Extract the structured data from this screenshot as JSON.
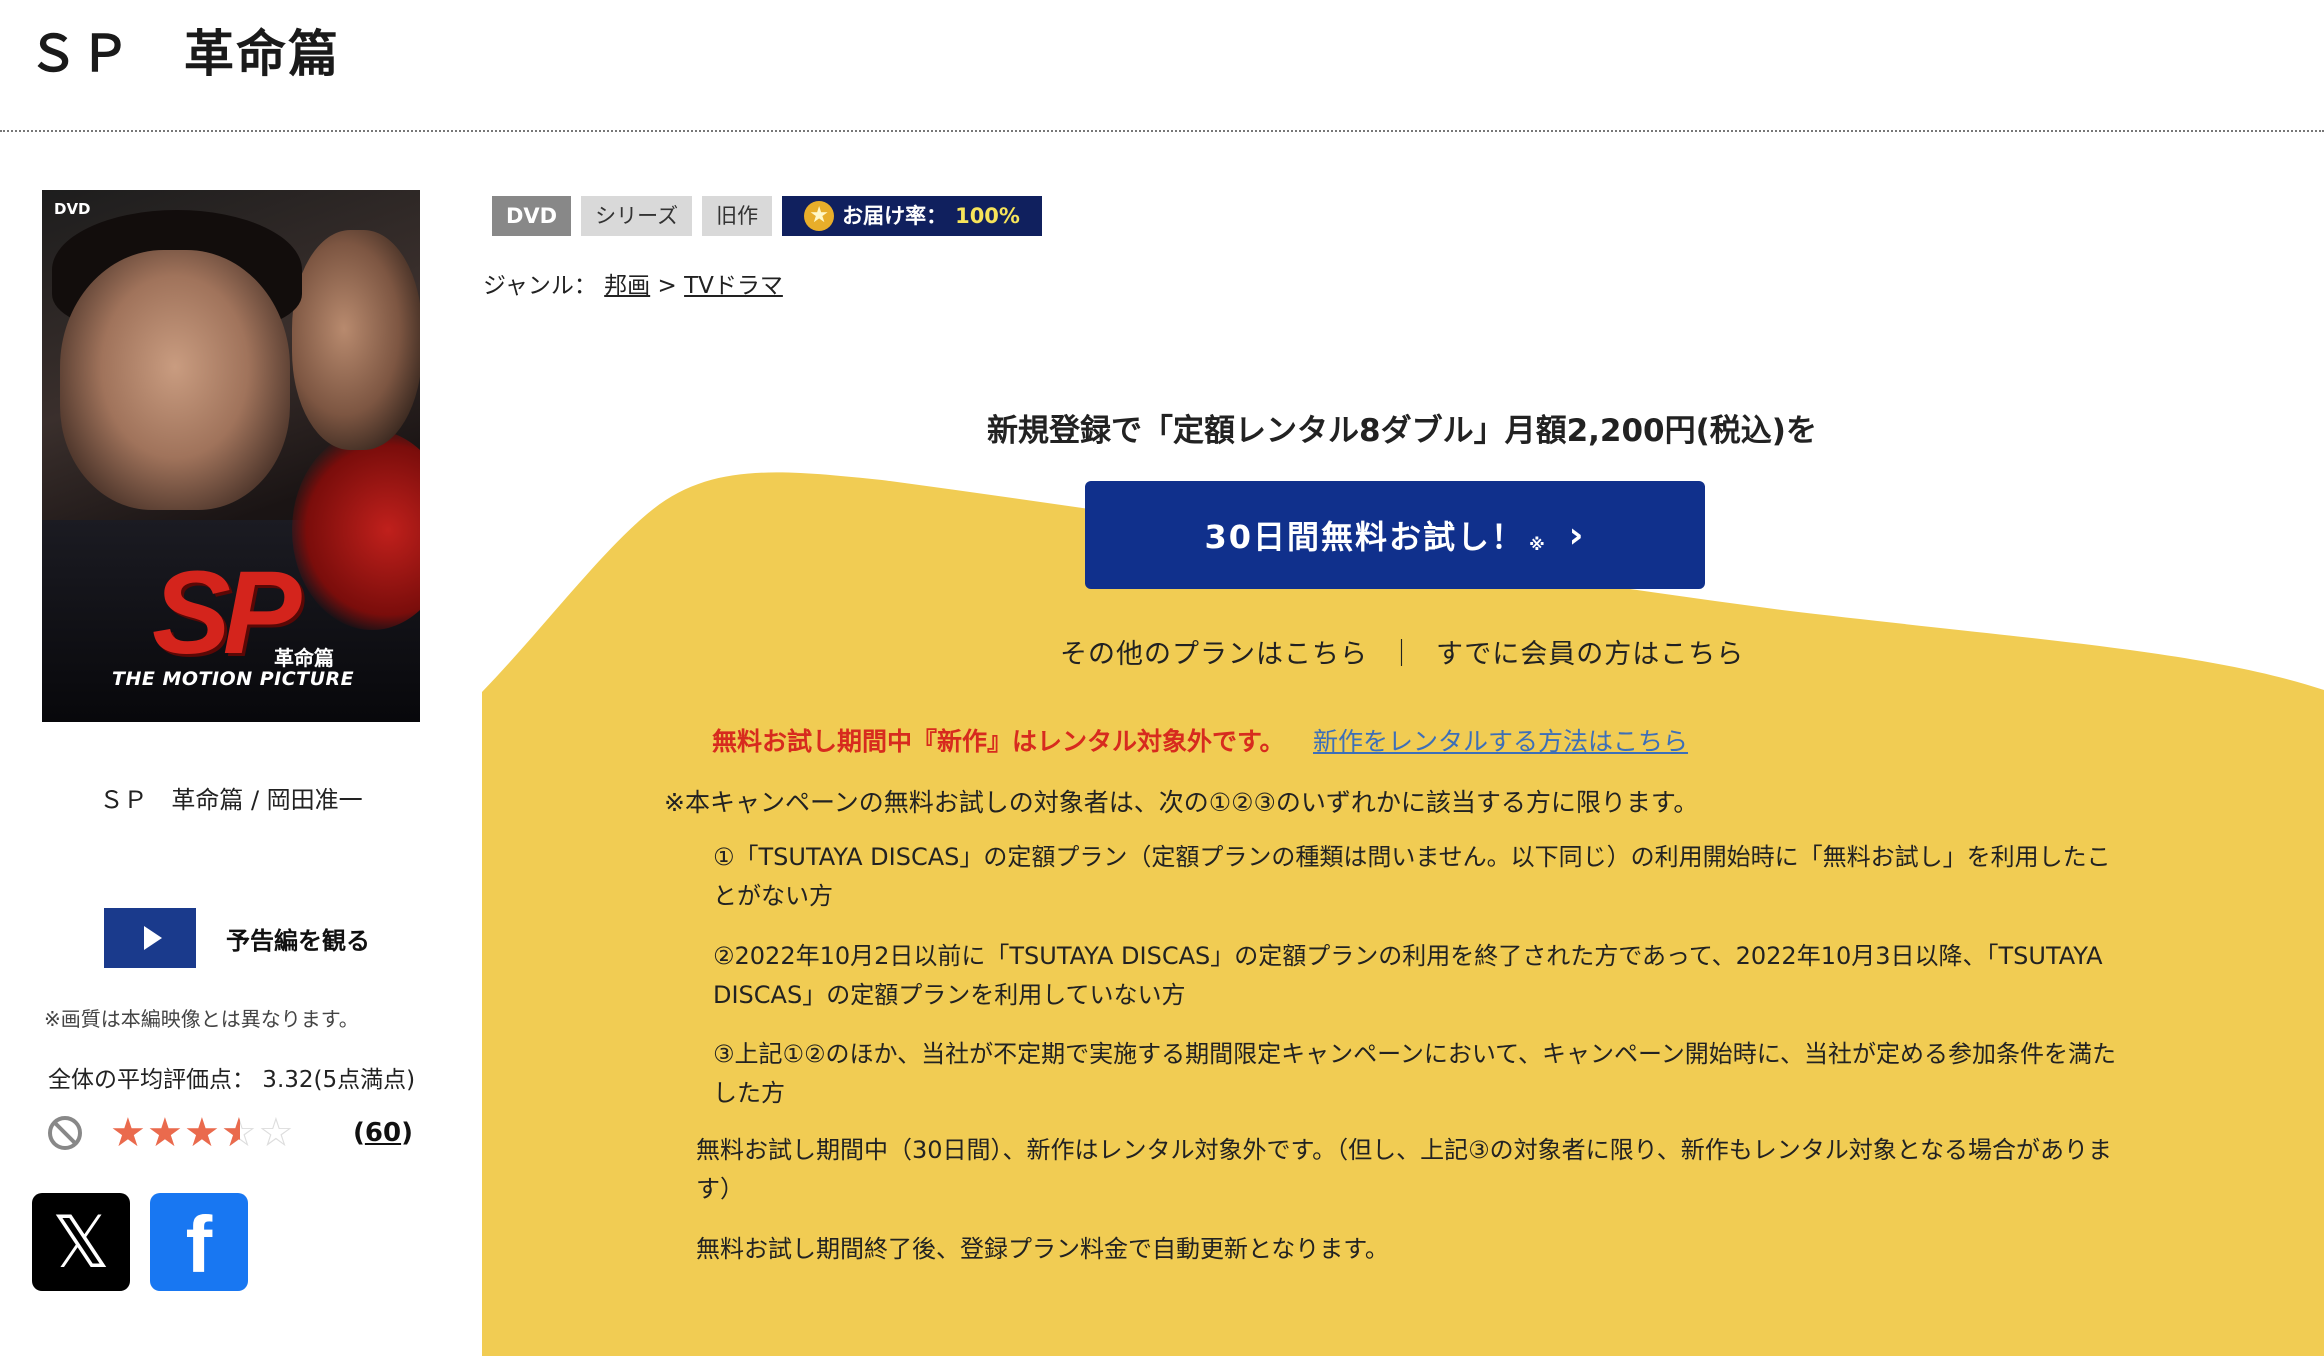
{
  "page": {
    "title": "ＳＰ　革命篇"
  },
  "cover": {
    "dvd_logo": "DVD",
    "logo_main": "SP",
    "logo_sub": "革命篇",
    "logo_tagline": "THE MOTION PICTURE"
  },
  "product": {
    "caption": "ＳＰ　革命篇 / 岡田准一",
    "trailer_label": "予告編を観る",
    "quality_note": "※画質は本編映像とは異なります。",
    "avg_rating_text": "全体の平均評価点： 3.32(5点満点)",
    "rating_value": 3.32,
    "review_count": "60"
  },
  "tags": {
    "format": "DVD",
    "series": "シリーズ",
    "old": "旧作",
    "delivery_label": "お届け率：",
    "delivery_rate": "100%"
  },
  "genre": {
    "label": "ジャンル：",
    "category": "邦画",
    "separator": " > ",
    "subcategory": "TVドラマ"
  },
  "promo": {
    "heading": "新規登録で「定額レンタル8ダブル」月額2,200円(税込)を",
    "button_label": "30日間無料お試し！",
    "button_note_mark": "※",
    "other_plans": "その他のプランはこちら",
    "divider": "｜",
    "members": "すでに会員の方はこちら",
    "notice_red": "無料お試し期間中『新作』はレンタル対象外です。",
    "notice_link": "新作をレンタルする方法はこちら",
    "campaign_note": "※本キャンペーンの無料お試しの対象者は、次の①②③のいずれかに該当する方に限ります。",
    "conditions": [
      "①「TSUTAYA DISCAS」の定額プラン（定額プランの種類は問いません。以下同じ）の利用開始時に「無料お試し」を利用したことがない方",
      "②2022年10月2日以前に「TSUTAYA DISCAS」の定額プランの利用を終了された方であって、2022年10月3日以降、「TSUTAYA DISCAS」の定額プランを利用していない方",
      "③上記①②のほか、当社が不定期で実施する期間限定キャンペーンにおいて、キャンペーン開始時に、当社が定める参加条件を満たした方"
    ],
    "paragraph1": "無料お試し期間中（30日間）、新作はレンタル対象外です。（但し、上記③の対象者に限り、新作もレンタル対象となる場合があります）",
    "paragraph2": "無料お試し期間終了後、登録プラン料金で自動更新となります。"
  },
  "share": {
    "x_icon": "x-logo",
    "facebook_icon": "facebook-logo"
  },
  "colors": {
    "accent_blue": "#10308c",
    "promo_yellow": "#f1cc53",
    "notice_red": "#d72b1e",
    "star_orange": "#ea6a4d"
  }
}
